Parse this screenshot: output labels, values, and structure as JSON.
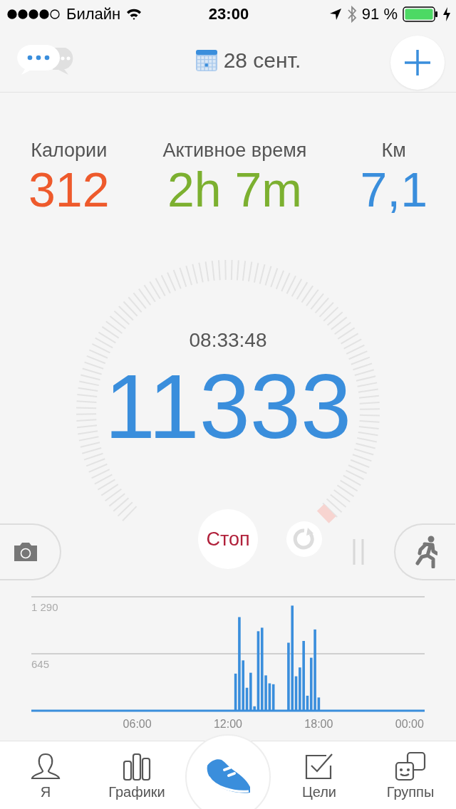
{
  "status_bar": {
    "carrier": "Билайн",
    "time": "23:00",
    "battery": "91 %"
  },
  "header": {
    "date": "28 сент."
  },
  "stats": [
    {
      "label": "Калории",
      "value": "312",
      "color": "#ee5a2c"
    },
    {
      "label": "Активное время",
      "value": "2h 7m",
      "color": "#7cb030"
    },
    {
      "label": "Км",
      "value": "7,1",
      "color": "#3a8edc"
    }
  ],
  "dial": {
    "time": "08:33:48",
    "steps": "11333"
  },
  "controls": {
    "stop": "Стоп"
  },
  "chart_data": {
    "type": "bar",
    "x": [
      12.5,
      12.75,
      13,
      13.25,
      13.5,
      13.75,
      14,
      14.25,
      14.5,
      14.75,
      15,
      16,
      16.25,
      16.5,
      16.75,
      17,
      17.25,
      17.5,
      17.75,
      18
    ],
    "values": [
      420,
      1060,
      570,
      260,
      430,
      50,
      900,
      940,
      400,
      310,
      300,
      770,
      1190,
      390,
      490,
      790,
      170,
      600,
      920,
      150
    ],
    "xlim": [
      -1,
      25
    ],
    "ylim": [
      0,
      1290
    ],
    "xticks": [
      {
        "value": 6,
        "label": "06:00"
      },
      {
        "value": 12,
        "label": "12:00"
      },
      {
        "value": 18,
        "label": "18:00"
      },
      {
        "value": 24,
        "label": "00:00"
      }
    ],
    "yticks": [
      {
        "value": 645,
        "label": "645"
      },
      {
        "value": 1290,
        "label": "1 290"
      }
    ]
  },
  "tabs": [
    {
      "label": "Я",
      "selected": false
    },
    {
      "label": "Графики",
      "selected": false
    },
    {
      "label": "Цели",
      "selected": false
    },
    {
      "label": "Группы",
      "selected": false
    }
  ]
}
